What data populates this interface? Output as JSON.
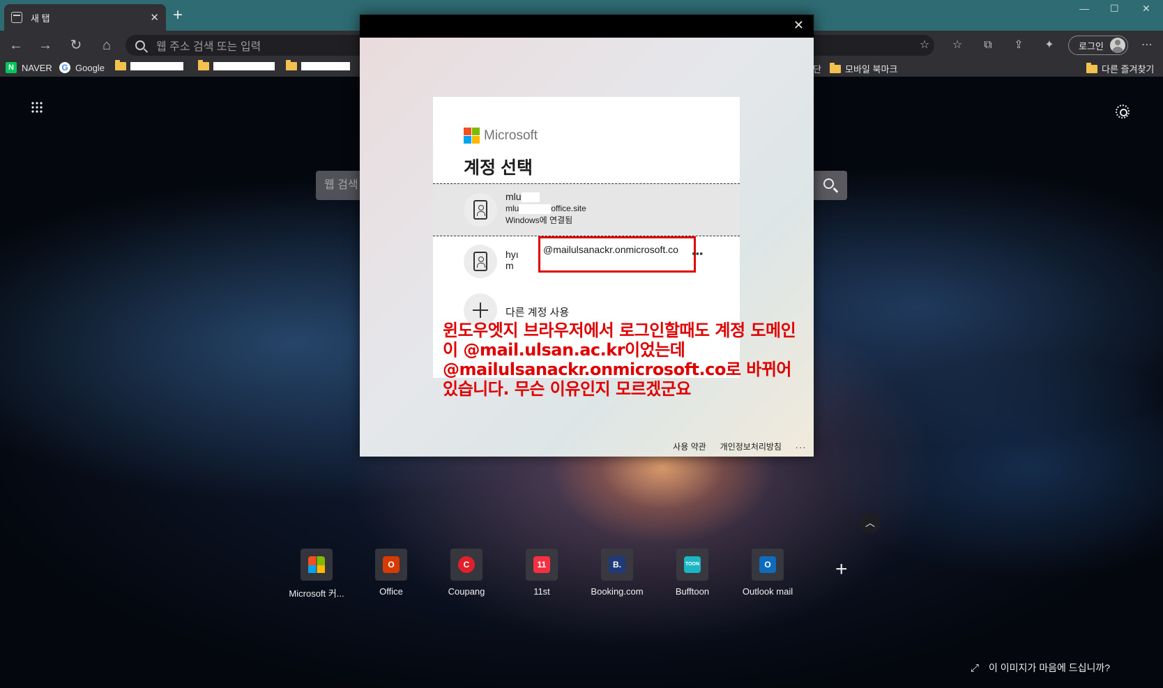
{
  "browser": {
    "tab_title": "새 탭",
    "tab_close": "✕",
    "new_tab": "+",
    "address_placeholder": "웹 주소 검색 또는 입력",
    "login_label": "로그인",
    "more": "⋯",
    "win_min": "—",
    "win_max": "☐",
    "win_close": "✕"
  },
  "bookmarks": {
    "naver": "NAVER",
    "naver_icon": "N",
    "google": "Google",
    "google_icon": "G",
    "partial_left": "단",
    "mobile": "모바일 북마크",
    "other": "다른 즐겨찾기"
  },
  "ntp": {
    "search_placeholder": "웹 검색",
    "collapse": "︿",
    "add": "+",
    "feedback": "이 이미지가 마음에 드십니까?",
    "quick_links": [
      {
        "label": "Microsoft 커...",
        "color": "#3a3a40",
        "glyph": ""
      },
      {
        "label": "Office",
        "color": "#d83b01",
        "glyph": "O"
      },
      {
        "label": "Coupang",
        "color": "#e0202a",
        "glyph": "C"
      },
      {
        "label": "11st",
        "color": "#f43142",
        "glyph": "11"
      },
      {
        "label": "Booking.com",
        "color": "#1f3a78",
        "glyph": "B."
      },
      {
        "label": "Bufftoon",
        "color": "#1bb5c4",
        "glyph": "TOON"
      },
      {
        "label": "Outlook mail",
        "color": "#0f6cbd",
        "glyph": "O"
      }
    ]
  },
  "dialog": {
    "close": "✕",
    "brand": "Microsoft",
    "heading": "계정 선택",
    "account1": {
      "name": "mlu",
      "email_start": "mlu",
      "email_end": "office.site",
      "status": "Windows에 연결됨"
    },
    "account2": {
      "name_line1": "hyı",
      "name_line2": "m",
      "email": "@mailulsanackr.onmicrosoft.co",
      "more": "⋮"
    },
    "add_account": "다른 계정 사용",
    "footer_terms": "사용 약관",
    "footer_privacy": "개인정보처리방침",
    "footer_more": "..."
  },
  "annotation": "윈도우엣지 브라우저에서 로그인할때도 계정 도메인이 @mail.ulsan.ac.kr이었는데 @mailulsanackr.onmicrosoft.co로 바뀌어 있습니다. 무슨 이유인지 모르겠군요",
  "colors": {
    "annotation": "#e00000",
    "tab_strip": "#2e6b72",
    "toolbar": "#303035"
  }
}
